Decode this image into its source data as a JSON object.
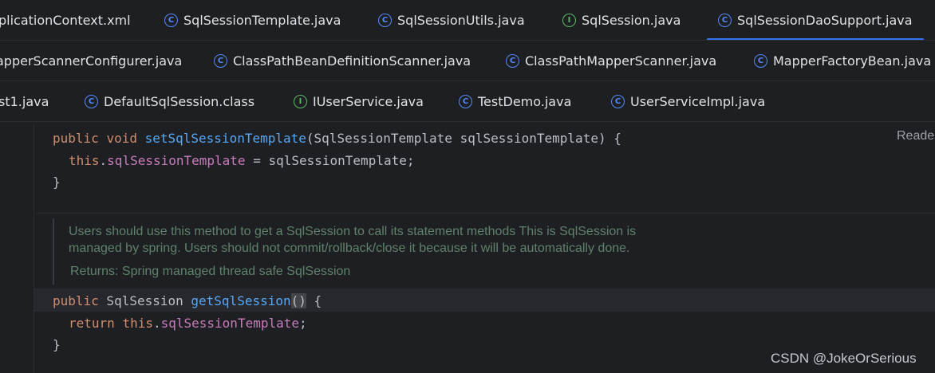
{
  "tabs_row1": [
    {
      "label": "plicationContext.xml",
      "icon": "",
      "icon_name": "xml-file-icon"
    },
    {
      "label": "SqlSessionTemplate.java",
      "icon": "C",
      "icon_name": "class-icon"
    },
    {
      "label": "SqlSessionUtils.java",
      "icon": "C",
      "icon_name": "class-icon"
    },
    {
      "label": "SqlSession.java",
      "icon": "I",
      "icon_name": "interface-icon"
    },
    {
      "label": "SqlSessionDaoSupport.java",
      "icon": "C",
      "icon_name": "class-icon",
      "active": true
    }
  ],
  "tabs_row2": [
    {
      "label": "apperScannerConfigurer.java",
      "icon": ""
    },
    {
      "label": "ClassPathBeanDefinitionScanner.java",
      "icon": "C"
    },
    {
      "label": "ClassPathMapperScanner.java",
      "icon": "C"
    },
    {
      "label": "MapperFactoryBean.java",
      "icon": "C"
    }
  ],
  "tabs_row3": [
    {
      "label": "st1.java",
      "icon": ""
    },
    {
      "label": "DefaultSqlSession.class",
      "icon": "C"
    },
    {
      "label": "IUserService.java",
      "icon": "I"
    },
    {
      "label": "TestDemo.java",
      "icon": "C"
    },
    {
      "label": "UserServiceImpl.java",
      "icon": "C"
    }
  ],
  "reader_mode_label": "Reade",
  "code": {
    "setter_signature": {
      "kw1": "public",
      "kw2": "void",
      "method": "setSqlSessionTemplate",
      "params": "(SqlSessionTemplate sqlSessionTemplate) {"
    },
    "setter_body": {
      "kw": "this",
      "dot": ".",
      "field": "sqlSessionTemplate",
      "rest": " = sqlSessionTemplate;"
    },
    "setter_close": "}",
    "getter_signature": {
      "kw": "public",
      "type": " SqlSession ",
      "method": "getSqlSession",
      "parens": "()",
      "rest": " {"
    },
    "getter_body": {
      "kw1": "return",
      "kw2": "this",
      "dot": ".",
      "field": "sqlSessionTemplate",
      "semi": ";"
    },
    "getter_close": "}"
  },
  "javadoc": {
    "line1": "Users should use this method to get a SqlSession to call its statement methods This is SqlSession is",
    "line2": "managed by spring. Users should not commit/rollback/close it because it will be automatically done.",
    "returns": "Returns: Spring managed thread safe SqlSession"
  },
  "watermark": "CSDN @JokeOrSerious",
  "colors": {
    "keyword": "#cf8e6d",
    "method": "#56a8f5",
    "field": "#c77dbb",
    "doc": "#5f826b",
    "active_tab_underline": "#3574f0"
  }
}
